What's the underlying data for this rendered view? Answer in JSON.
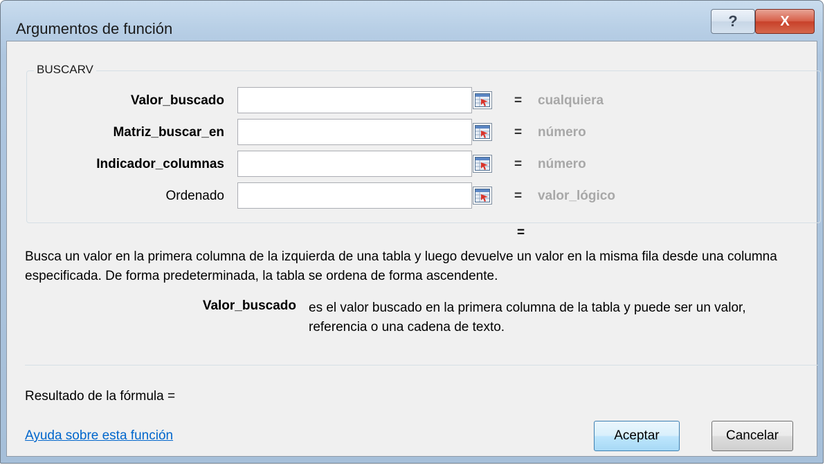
{
  "window": {
    "title": "Argumentos de función",
    "help_glyph": "?",
    "close_glyph": "X"
  },
  "group": {
    "label": "BUSCARV"
  },
  "arguments": [
    {
      "label": "Valor_buscado",
      "value": "",
      "equals": "=",
      "type_hint": "cualquiera",
      "required": true
    },
    {
      "label": "Matriz_buscar_en",
      "value": "",
      "equals": "=",
      "type_hint": "número",
      "required": true
    },
    {
      "label": "Indicador_columnas",
      "value": "",
      "equals": "=",
      "type_hint": "número",
      "required": true
    },
    {
      "label": "Ordenado",
      "value": "",
      "equals": "=",
      "type_hint": "valor_lógico",
      "required": false
    }
  ],
  "result_equals": "=",
  "description": "Busca un valor en la primera columna de la izquierda de una tabla y luego devuelve un valor en la misma fila desde una columna especificada. De forma predeterminada, la tabla se ordena de forma ascendente.",
  "arg_help": {
    "name": "Valor_buscado",
    "text": "es el valor buscado en la primera columna de la tabla y puede ser un valor, referencia o una cadena de texto."
  },
  "formula_result_label": "Resultado de la fórmula =",
  "help_link": "Ayuda sobre esta función",
  "buttons": {
    "ok": "Aceptar",
    "cancel": "Cancelar"
  },
  "icons": {
    "collapse_dialog": "collapse-dialog-icon"
  }
}
